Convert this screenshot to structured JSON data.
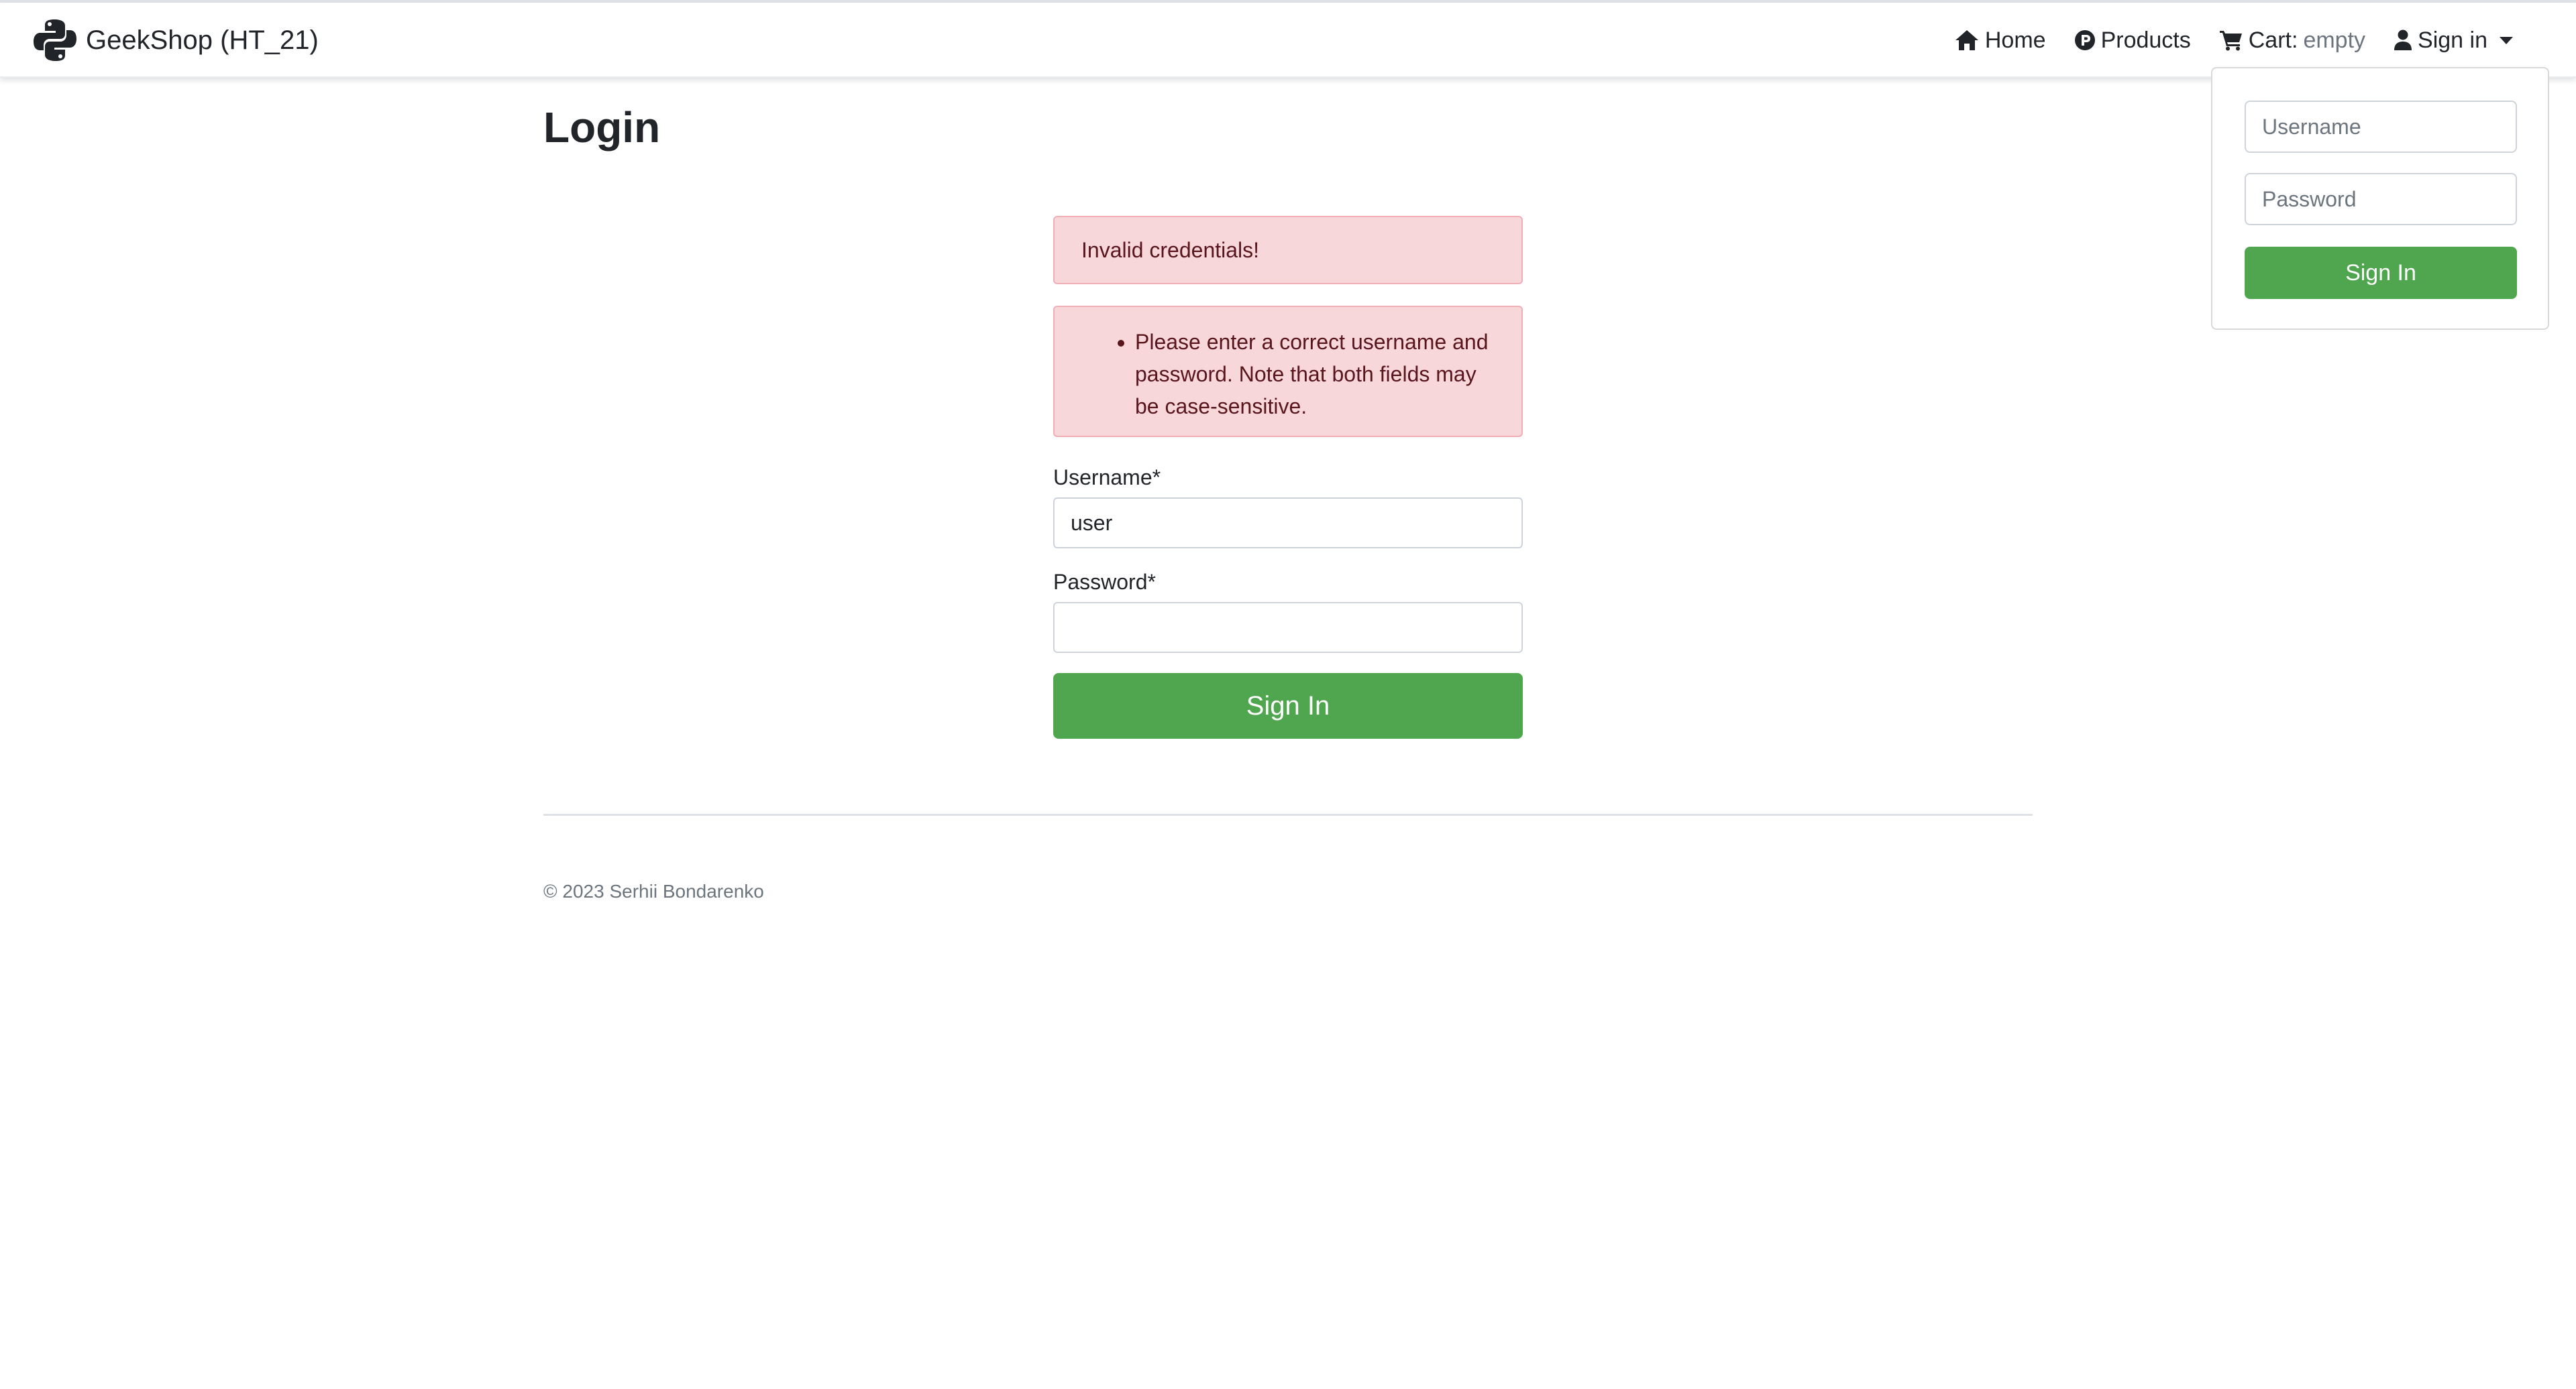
{
  "brand": {
    "title": "GeekShop (HT_21)"
  },
  "nav": {
    "home": "Home",
    "products": "Products",
    "cart_label": "Cart:",
    "cart_status": "empty",
    "signin": "Sign in"
  },
  "dropdown": {
    "username_placeholder": "Username",
    "password_placeholder": "Password",
    "button": "Sign In"
  },
  "page": {
    "title": "Login"
  },
  "alerts": {
    "message": "Invalid credentials!",
    "errors": [
      "Please enter a correct username and password. Note that both fields may be case-sensitive."
    ]
  },
  "form": {
    "username_label": "Username*",
    "username_value": "user",
    "password_label": "Password*",
    "password_value": "",
    "submit": "Sign In"
  },
  "footer": {
    "copyright": "© 2023 Serhii Bondarenko"
  },
  "colors": {
    "button": "#4fa64e",
    "alert_bg": "#f8d7da",
    "alert_text": "#58151c",
    "muted": "#6c757d"
  }
}
